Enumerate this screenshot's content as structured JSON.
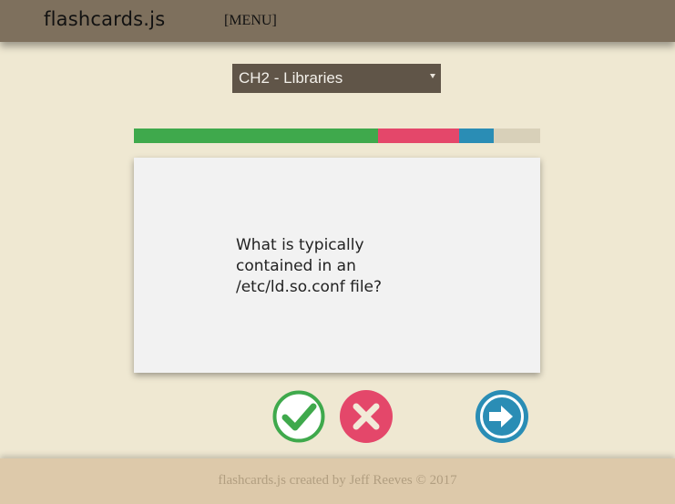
{
  "header": {
    "brand": "flashcards.js",
    "menu_label": "[MENU]"
  },
  "deck_select": {
    "selected": "CH2 - Libraries"
  },
  "progress": {
    "correct_fraction": 0.6,
    "wrong_fraction": 0.2,
    "current_fraction": 0.085,
    "remaining_fraction": 0.115,
    "colors": {
      "correct": "#3fa94c",
      "wrong": "#e4476a",
      "current": "#2a8db5",
      "remaining": "#d8d0b9"
    }
  },
  "card": {
    "question": "What is typically contained in an /etc/ld.so.conf file?"
  },
  "actions": {
    "correct_icon": "check-icon",
    "wrong_icon": "x-icon",
    "next_icon": "arrow-right-icon"
  },
  "footer": {
    "text": "flashcards.js created by Jeff Reeves © 2017"
  }
}
